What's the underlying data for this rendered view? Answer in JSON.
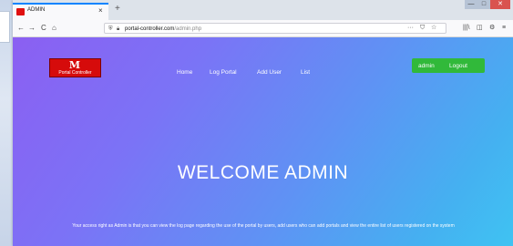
{
  "browser": {
    "tab_title": "ADMIN",
    "tab_close": "×",
    "new_tab": "+",
    "window_min": "—",
    "window_max": "□",
    "window_close": "✕",
    "back": "←",
    "forward": "→",
    "reload": "C",
    "home": "⌂",
    "url_domain": "portal-controller.com",
    "url_path": "/admin.php",
    "url_more": "···",
    "url_pocket": "⛉",
    "url_star": "☆",
    "library": "|||\\",
    "sidebar": "◫",
    "extension": "⚙",
    "menu": "≡"
  },
  "header": {
    "logo_mark": "M",
    "logo_text": "Portal Controller",
    "nav": [
      "Home",
      "Log Portal",
      "Add User",
      "List"
    ],
    "username": "admin",
    "logout_label": "Logout"
  },
  "main": {
    "welcome": "WELCOME ADMIN",
    "description": "Your access right as Admin is that you can view the log page regarding the use of the portal by users, add users who can add portals and view the entire list of users registered on the system"
  },
  "colors": {
    "gradient_start": "#8b5ff2",
    "gradient_end": "#3fc3f2",
    "logo_bg": "#d60b0b",
    "user_button": "#31b93a",
    "tab_accent": "#0a84ff"
  }
}
